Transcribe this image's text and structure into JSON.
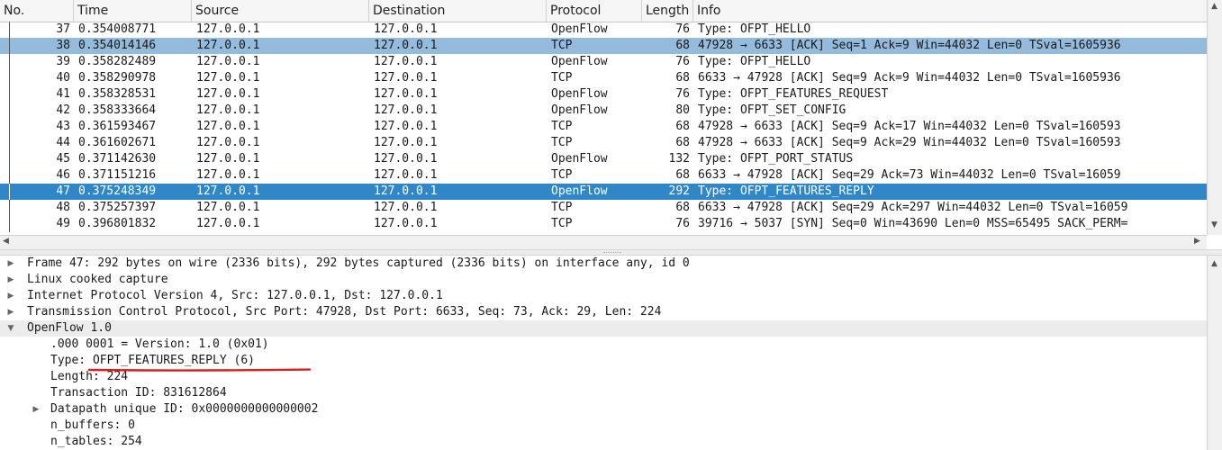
{
  "columns": {
    "no": "No.",
    "time": "Time",
    "source": "Source",
    "destination": "Destination",
    "protocol": "Protocol",
    "length": "Length",
    "info": "Info"
  },
  "packets": [
    {
      "no": "37",
      "time": "0.354008771",
      "src": "127.0.0.1",
      "dst": "127.0.0.1",
      "proto": "OpenFlow",
      "len": "76",
      "info": "Type: OFPT_HELLO"
    },
    {
      "no": "38",
      "time": "0.354014146",
      "src": "127.0.0.1",
      "dst": "127.0.0.1",
      "proto": "TCP",
      "len": "68",
      "info": "47928 → 6633 [ACK] Seq=1 Ack=9 Win=44032 Len=0 TSval=1605936"
    },
    {
      "no": "39",
      "time": "0.358282489",
      "src": "127.0.0.1",
      "dst": "127.0.0.1",
      "proto": "OpenFlow",
      "len": "76",
      "info": "Type: OFPT_HELLO"
    },
    {
      "no": "40",
      "time": "0.358290978",
      "src": "127.0.0.1",
      "dst": "127.0.0.1",
      "proto": "TCP",
      "len": "68",
      "info": "6633 → 47928 [ACK] Seq=9 Ack=9 Win=44032 Len=0 TSval=1605936"
    },
    {
      "no": "41",
      "time": "0.358328531",
      "src": "127.0.0.1",
      "dst": "127.0.0.1",
      "proto": "OpenFlow",
      "len": "76",
      "info": "Type: OFPT_FEATURES_REQUEST"
    },
    {
      "no": "42",
      "time": "0.358333664",
      "src": "127.0.0.1",
      "dst": "127.0.0.1",
      "proto": "OpenFlow",
      "len": "80",
      "info": "Type: OFPT_SET_CONFIG"
    },
    {
      "no": "43",
      "time": "0.361593467",
      "src": "127.0.0.1",
      "dst": "127.0.0.1",
      "proto": "TCP",
      "len": "68",
      "info": "47928 → 6633 [ACK] Seq=9 Ack=17 Win=44032 Len=0 TSval=160593"
    },
    {
      "no": "44",
      "time": "0.361602671",
      "src": "127.0.0.1",
      "dst": "127.0.0.1",
      "proto": "TCP",
      "len": "68",
      "info": "47928 → 6633 [ACK] Seq=9 Ack=29 Win=44032 Len=0 TSval=160593"
    },
    {
      "no": "45",
      "time": "0.371142630",
      "src": "127.0.0.1",
      "dst": "127.0.0.1",
      "proto": "OpenFlow",
      "len": "132",
      "info": "Type: OFPT_PORT_STATUS"
    },
    {
      "no": "46",
      "time": "0.371151216",
      "src": "127.0.0.1",
      "dst": "127.0.0.1",
      "proto": "TCP",
      "len": "68",
      "info": "6633 → 47928 [ACK] Seq=29 Ack=73 Win=44032 Len=0 TSval=16059"
    },
    {
      "no": "47",
      "time": "0.375248349",
      "src": "127.0.0.1",
      "dst": "127.0.0.1",
      "proto": "OpenFlow",
      "len": "292",
      "info": "Type: OFPT_FEATURES_REPLY"
    },
    {
      "no": "48",
      "time": "0.375257397",
      "src": "127.0.0.1",
      "dst": "127.0.0.1",
      "proto": "TCP",
      "len": "68",
      "info": "6633 → 47928 [ACK] Seq=29 Ack=297 Win=44032 Len=0 TSval=16059"
    },
    {
      "no": "49",
      "time": "0.396801832",
      "src": "127.0.0.1",
      "dst": "127.0.0.1",
      "proto": "TCP",
      "len": "76",
      "info": "39716 → 5037 [SYN] Seq=0 Win=43690 Len=0 MSS=65495 SACK_PERM="
    }
  ],
  "details": [
    {
      "text": "Frame 47: 292 bytes on wire (2336 bits), 292 bytes captured (2336 bits) on interface any, id 0",
      "indent": 0,
      "toggle": "collapsed"
    },
    {
      "text": "Linux cooked capture",
      "indent": 0,
      "toggle": "collapsed"
    },
    {
      "text": "Internet Protocol Version 4, Src: 127.0.0.1, Dst: 127.0.0.1",
      "indent": 0,
      "toggle": "collapsed"
    },
    {
      "text": "Transmission Control Protocol, Src Port: 47928, Dst Port: 6633, Seq: 73, Ack: 29, Len: 224",
      "indent": 0,
      "toggle": "collapsed"
    },
    {
      "text": "OpenFlow 1.0",
      "indent": 0,
      "toggle": "expanded"
    },
    {
      "text": ".000 0001 = Version: 1.0 (0x01)",
      "indent": 1,
      "toggle": "none"
    },
    {
      "text": "Type: OFPT_FEATURES_REPLY (6)",
      "indent": 1,
      "toggle": "none"
    },
    {
      "text": "Length: 224",
      "indent": 1,
      "toggle": "none"
    },
    {
      "text": "Transaction ID: 831612864",
      "indent": 1,
      "toggle": "none"
    },
    {
      "text": "Datapath unique ID: 0x0000000000000002",
      "indent": 1,
      "toggle": "collapsed"
    },
    {
      "text": "n_buffers: 0",
      "indent": 1,
      "toggle": "none"
    },
    {
      "text": "n_tables: 254",
      "indent": 1,
      "toggle": "none"
    }
  ],
  "colors": {
    "selected_row": "#2f87c8",
    "related_row": "#94bbdc",
    "annotation": "#d62020"
  }
}
